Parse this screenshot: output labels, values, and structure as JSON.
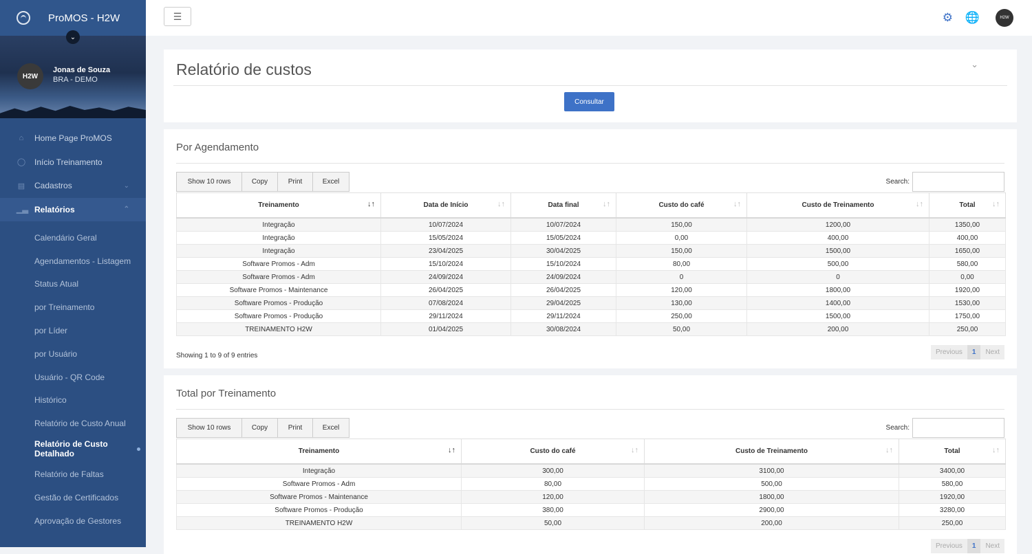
{
  "app": {
    "title": "ProMOS - H2W"
  },
  "user": {
    "initials": "H2W",
    "name": "Jonas de Souza",
    "org": "BRA - DEMO",
    "header_avatar": "H2W"
  },
  "sidebar": {
    "items": [
      {
        "label": "Home Page ProMOS",
        "icon": "home-icon"
      },
      {
        "label": "Início Treinamento",
        "icon": "user-circle-icon"
      },
      {
        "label": "Cadastros",
        "icon": "list-icon"
      },
      {
        "label": "Relatórios",
        "icon": "bar-chart-icon"
      }
    ],
    "subitems": [
      "Calendário Geral",
      "Agendamentos - Listagem",
      "Status Atual",
      "por Treinamento",
      "por Líder",
      "por Usuário",
      "Usuário - QR Code",
      "Histórico",
      "Relatório de Custo Anual",
      "Relatório de Custo Detalhado",
      "Relatório de Faltas",
      "Gestão de Certificados",
      "Aprovação de Gestores"
    ]
  },
  "page": {
    "title": "Relatório de custos",
    "consultar": "Consultar"
  },
  "toolbar": {
    "show_rows": "Show 10 rows",
    "copy": "Copy",
    "print": "Print",
    "excel": "Excel",
    "search_label": "Search:"
  },
  "agendamento": {
    "title": "Por Agendamento",
    "columns": [
      "Treinamento",
      "Data de Início",
      "Data final",
      "Custo do café",
      "Custo de Treinamento",
      "Total"
    ],
    "rows": [
      [
        "Integração",
        "10/07/2024",
        "10/07/2024",
        "150,00",
        "1200,00",
        "1350,00"
      ],
      [
        "Integração",
        "15/05/2024",
        "15/05/2024",
        "0,00",
        "400,00",
        "400,00"
      ],
      [
        "Integração",
        "23/04/2025",
        "30/04/2025",
        "150,00",
        "1500,00",
        "1650,00"
      ],
      [
        "Software Promos - Adm",
        "15/10/2024",
        "15/10/2024",
        "80,00",
        "500,00",
        "580,00"
      ],
      [
        "Software Promos - Adm",
        "24/09/2024",
        "24/09/2024",
        "0",
        "0",
        "0,00"
      ],
      [
        "Software Promos - Maintenance",
        "26/04/2025",
        "26/04/2025",
        "120,00",
        "1800,00",
        "1920,00"
      ],
      [
        "Software Promos - Produção",
        "07/08/2024",
        "29/04/2025",
        "130,00",
        "1400,00",
        "1530,00"
      ],
      [
        "Software Promos - Produção",
        "29/11/2024",
        "29/11/2024",
        "250,00",
        "1500,00",
        "1750,00"
      ],
      [
        "TREINAMENTO H2W",
        "01/04/2025",
        "30/08/2024",
        "50,00",
        "200,00",
        "250,00"
      ]
    ],
    "info": "Showing 1 to 9 of 9 entries"
  },
  "total_treinamento": {
    "title": "Total por Treinamento",
    "columns": [
      "Treinamento",
      "Custo do café",
      "Custo de Treinamento",
      "Total"
    ],
    "rows": [
      [
        "Integração",
        "300,00",
        "3100,00",
        "3400,00"
      ],
      [
        "Software Promos - Adm",
        "80,00",
        "500,00",
        "580,00"
      ],
      [
        "Software Promos - Maintenance",
        "120,00",
        "1800,00",
        "1920,00"
      ],
      [
        "Software Promos - Produção",
        "380,00",
        "2900,00",
        "3280,00"
      ],
      [
        "TREINAMENTO H2W",
        "50,00",
        "200,00",
        "250,00"
      ]
    ]
  },
  "pager": {
    "previous": "Previous",
    "current": "1",
    "next": "Next"
  }
}
